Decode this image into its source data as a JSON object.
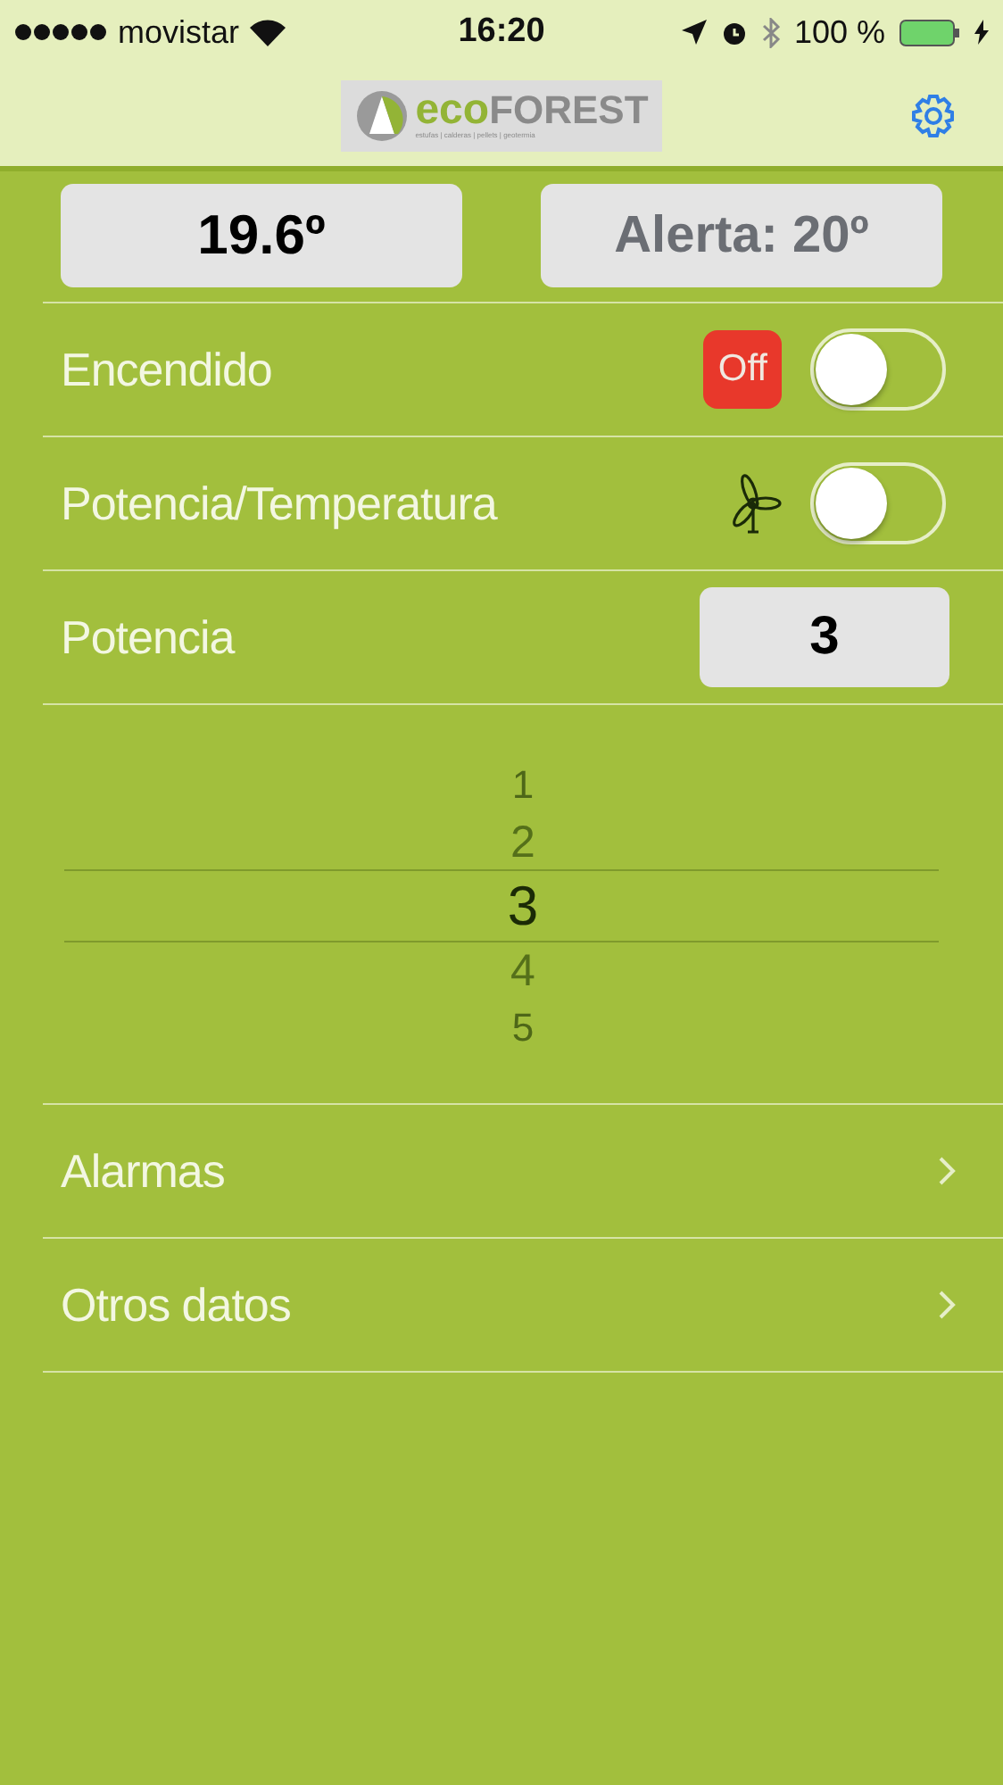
{
  "status_bar": {
    "carrier": "movistar",
    "time": "16:20",
    "battery": "100 %"
  },
  "nav": {
    "logo_brand": "eco",
    "logo_brand_2": "FOREST",
    "logo_tagline": "estufas | calderas | pellets | geotermia"
  },
  "readings": [
    {
      "text": "19.6º",
      "kind": "current"
    },
    {
      "text": "Alerta: 20º",
      "kind": "alert"
    }
  ],
  "rows": [
    {
      "kind": "switch",
      "label": "Encendido",
      "badge": "Off",
      "on": false
    },
    {
      "kind": "fan-switch",
      "label": "Potencia/Temperatura",
      "on": false
    },
    {
      "kind": "value",
      "label": "Potencia",
      "value": "3"
    }
  ],
  "picker": [
    {
      "label": "1",
      "selected": false
    },
    {
      "label": "2",
      "selected": false
    },
    {
      "label": "3",
      "selected": true
    },
    {
      "label": "4",
      "selected": false
    },
    {
      "label": "5",
      "selected": false
    }
  ],
  "links": [
    {
      "label": "Alarmas"
    },
    {
      "label": "Otros datos"
    }
  ]
}
